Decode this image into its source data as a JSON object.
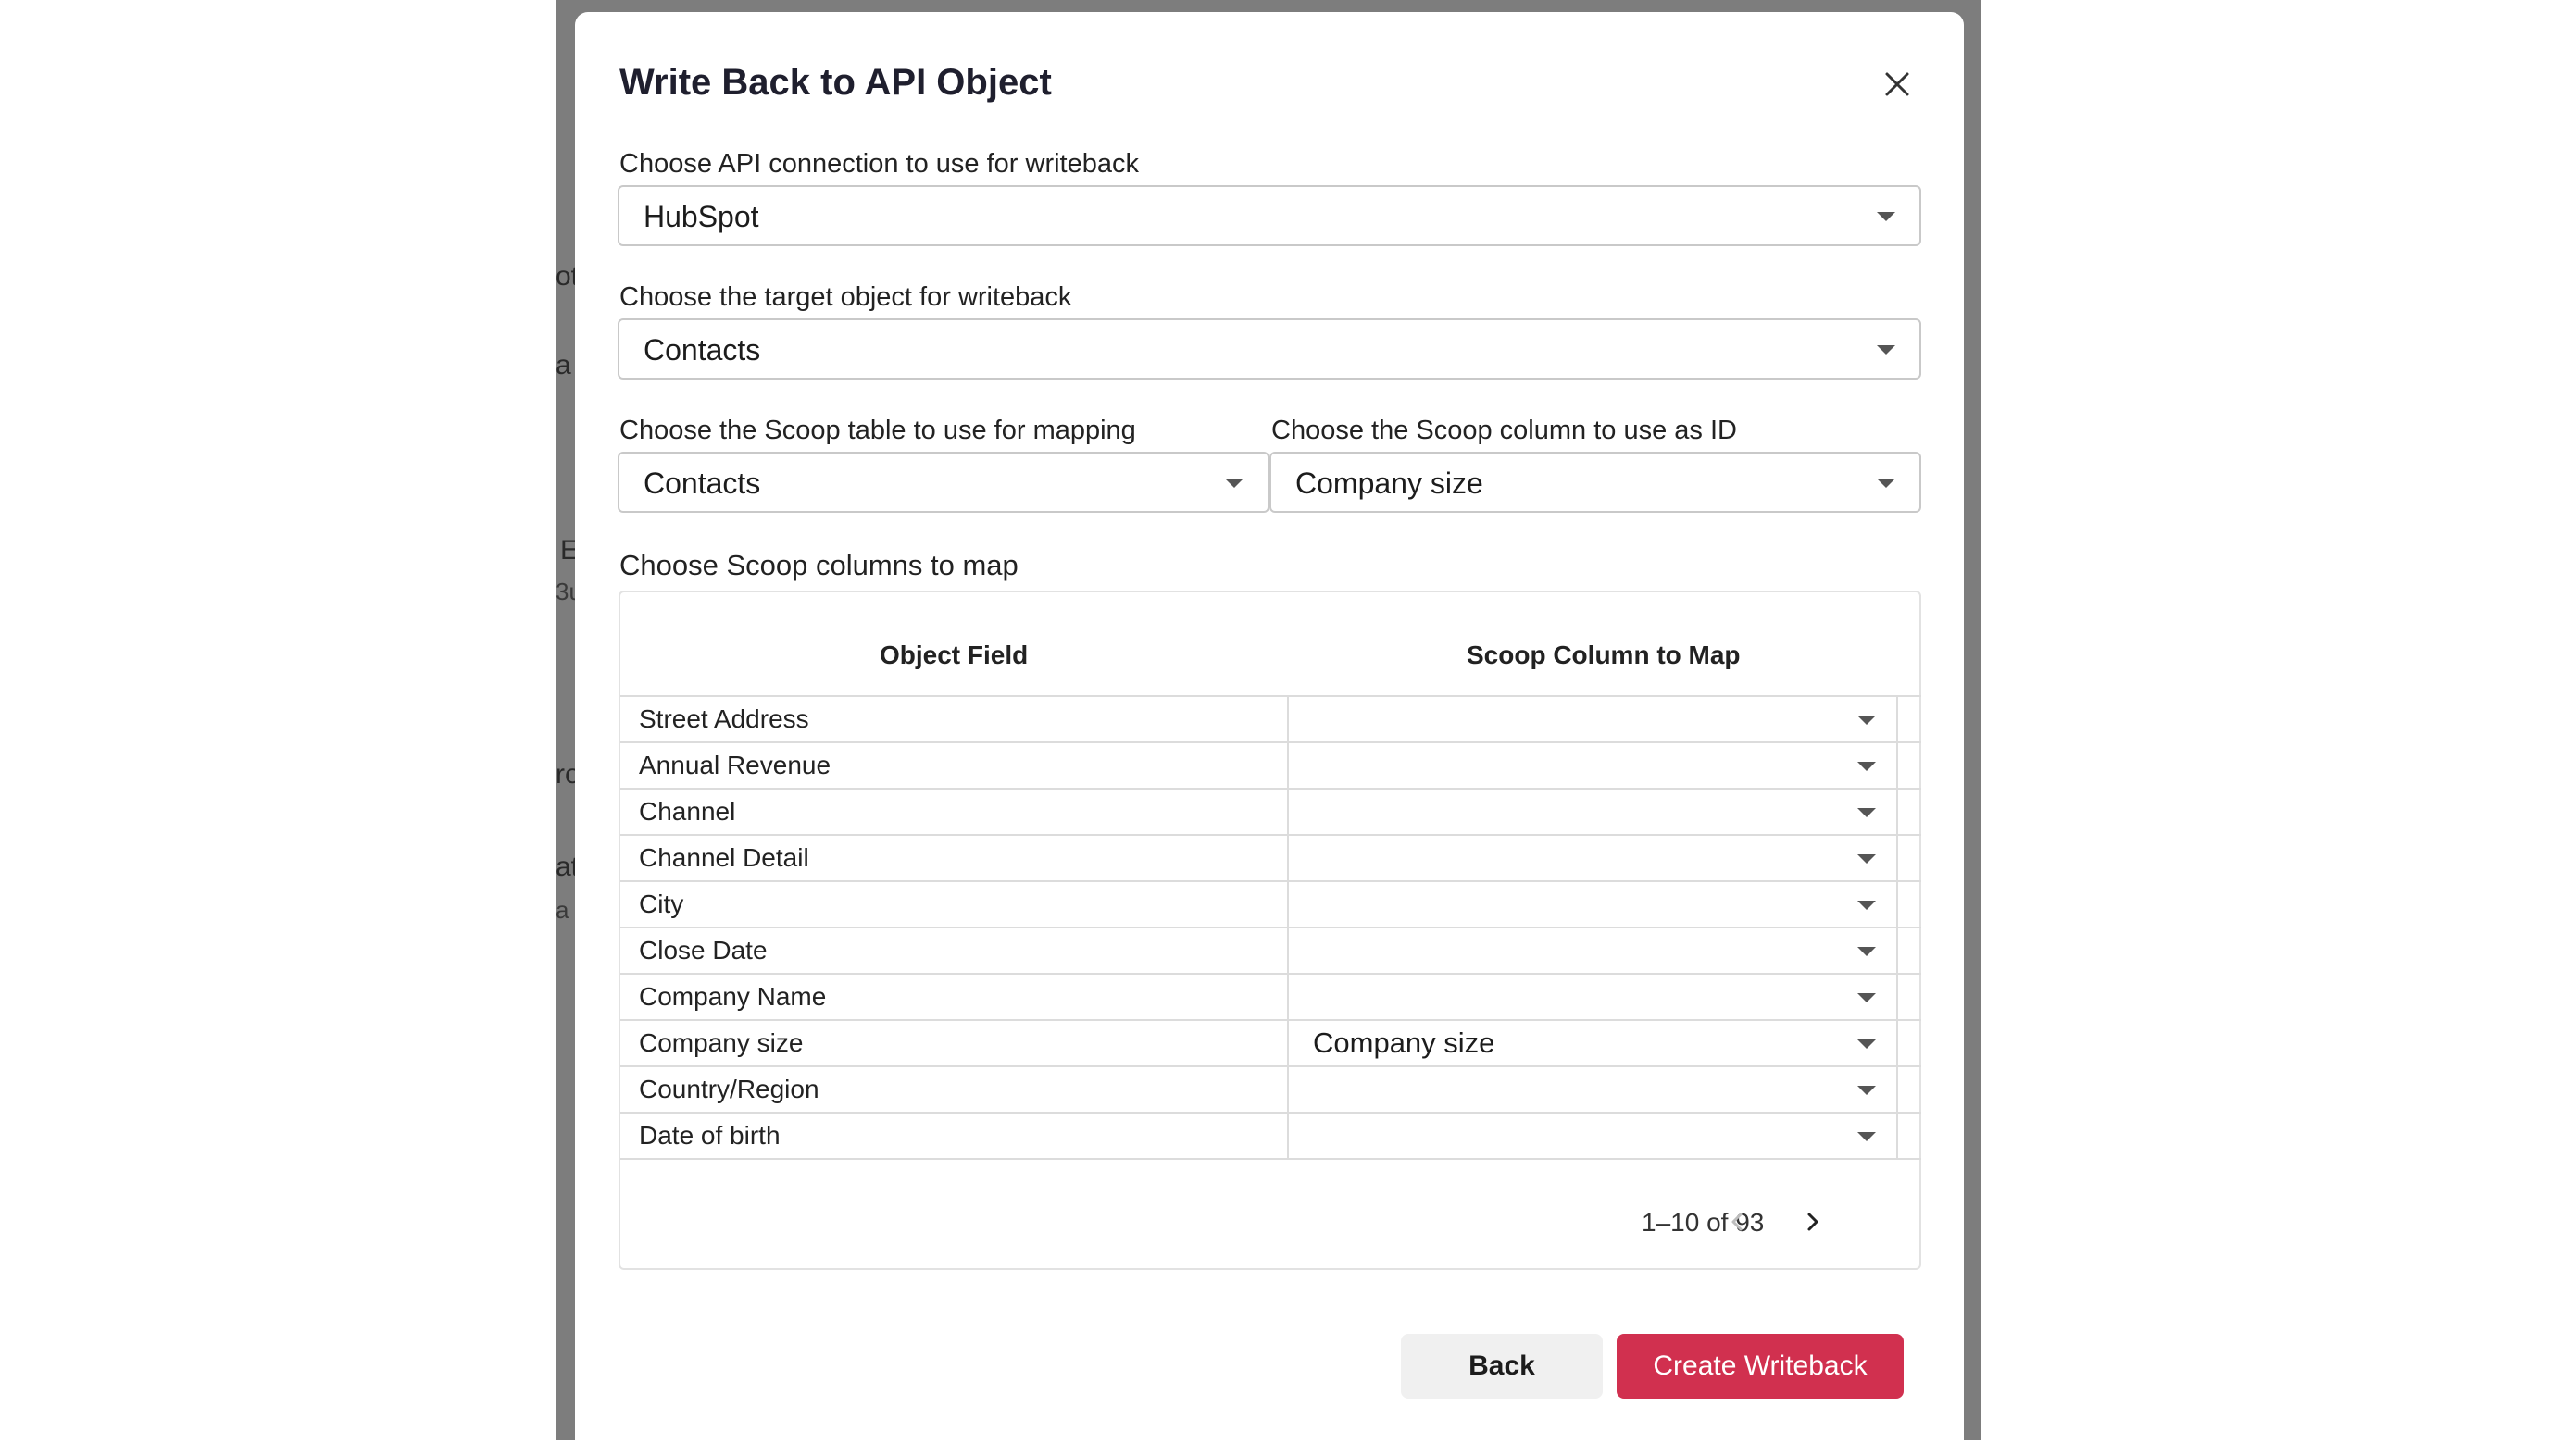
{
  "background": {
    "fragments": [
      "ot",
      "a",
      "E",
      "3u",
      "ro",
      "at",
      "a"
    ]
  },
  "modal": {
    "title": "Write Back to API Object",
    "close_icon": "close-icon"
  },
  "form": {
    "api_connection": {
      "label": "Choose API connection to use for writeback",
      "value": "HubSpot"
    },
    "target_object": {
      "label": "Choose the target object for writeback",
      "value": "Contacts"
    },
    "scoop_table": {
      "label": "Choose the Scoop table to use for mapping",
      "value": "Contacts"
    },
    "scoop_id_column": {
      "label": "Choose the Scoop column to use as ID",
      "value": "Company size"
    }
  },
  "mapping": {
    "section_label": "Choose Scoop columns to map",
    "headers": {
      "object_field": "Object Field",
      "scoop_column": "Scoop Column to Map"
    },
    "rows": [
      {
        "field": "Street Address",
        "mapped": ""
      },
      {
        "field": "Annual Revenue",
        "mapped": ""
      },
      {
        "field": "Channel",
        "mapped": ""
      },
      {
        "field": "Channel Detail",
        "mapped": ""
      },
      {
        "field": "City",
        "mapped": ""
      },
      {
        "field": "Close Date",
        "mapped": ""
      },
      {
        "field": "Company Name",
        "mapped": ""
      },
      {
        "field": "Company size",
        "mapped": "Company size"
      },
      {
        "field": "Country/Region",
        "mapped": ""
      },
      {
        "field": "Date of birth",
        "mapped": ""
      }
    ],
    "pagination": {
      "text": "1–10 of 93",
      "prev_icon": "chevron-left-icon",
      "next_icon": "chevron-right-icon"
    }
  },
  "actions": {
    "back_label": "Back",
    "create_label": "Create Writeback"
  },
  "colors": {
    "primary": "#d1304f",
    "backdrop": "#7d7d7d"
  }
}
